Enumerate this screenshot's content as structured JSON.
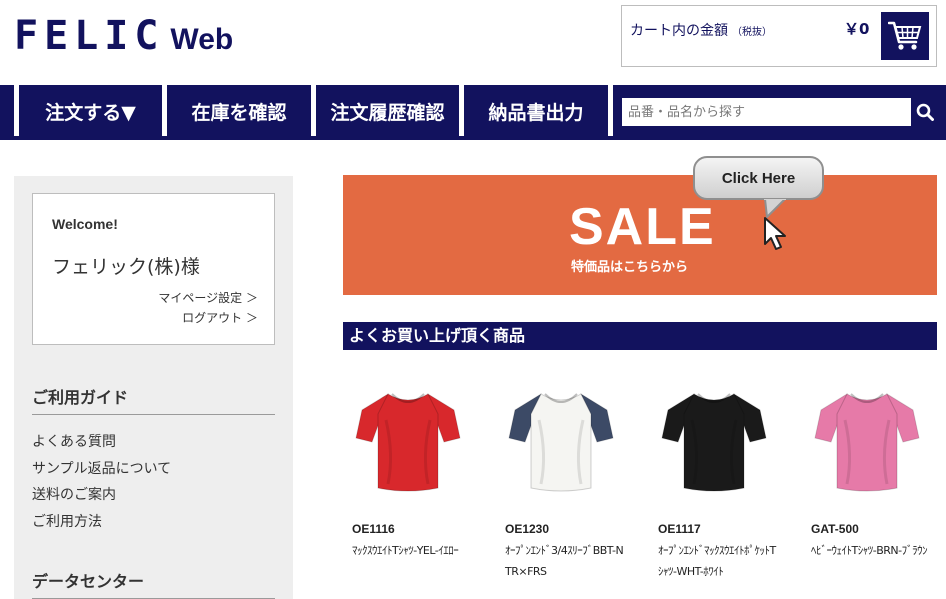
{
  "header": {
    "logo_main": "FELIC",
    "logo_sub": "Web",
    "cart_label": "カート内の金額",
    "cart_tax_note": "（税抜）",
    "cart_amount": "￥0"
  },
  "nav": {
    "items": [
      "注文する▼",
      "在庫を確認",
      "注文履歴確認",
      "納品書出力"
    ],
    "search_placeholder": "品番・品名から探す"
  },
  "sidebar": {
    "welcome_title": "Welcome!",
    "user_name": "フェリック(株)様",
    "mypage_link": "マイページ設定 ＞",
    "logout_link": "ログアウト ＞",
    "guide_title": "ご利用ガイド",
    "guide_items": [
      "よくある質問",
      "サンプル返品について",
      "送料のご案内",
      "ご利用方法"
    ],
    "data_center_title": "データセンター"
  },
  "banner": {
    "sale_text": "SALE",
    "sale_sub": "特価品はこちらから",
    "bubble_text": "Click Here"
  },
  "popular": {
    "title": "よくお買い上げ頂く商品",
    "products": [
      {
        "code": "OE1116",
        "name": "ﾏｯｸｽｳｴｲﾄTｼｬﾂ-YEL-ｲｴﾛｰ",
        "color": "#d8282c"
      },
      {
        "code": "OE1230",
        "name": "ｵｰﾌﾟﾝｴﾝﾄﾞ3/4ｽﾘｰﾌﾞBBT-NTR×FRS",
        "color": "#f5f5f2"
      },
      {
        "code": "OE1117",
        "name": "ｵｰﾌﾟﾝｴﾝﾄﾞﾏｯｸｽｳｴｲﾄﾎﾟｹｯﾄTｼｬﾂ-WHT-ﾎﾜｲﾄ",
        "color": "#1a1a1a"
      },
      {
        "code": "GAT-500",
        "name": "ﾍﾋﾞｰｳｪｲﾄTｼｬﾂ-BRN-ﾌﾞﾗｳﾝ",
        "color": "#e67aa8"
      }
    ]
  },
  "colors": {
    "brand_navy": "#12125e",
    "sale_orange": "#e36a42",
    "sidebar_gray": "#eeeeee"
  }
}
